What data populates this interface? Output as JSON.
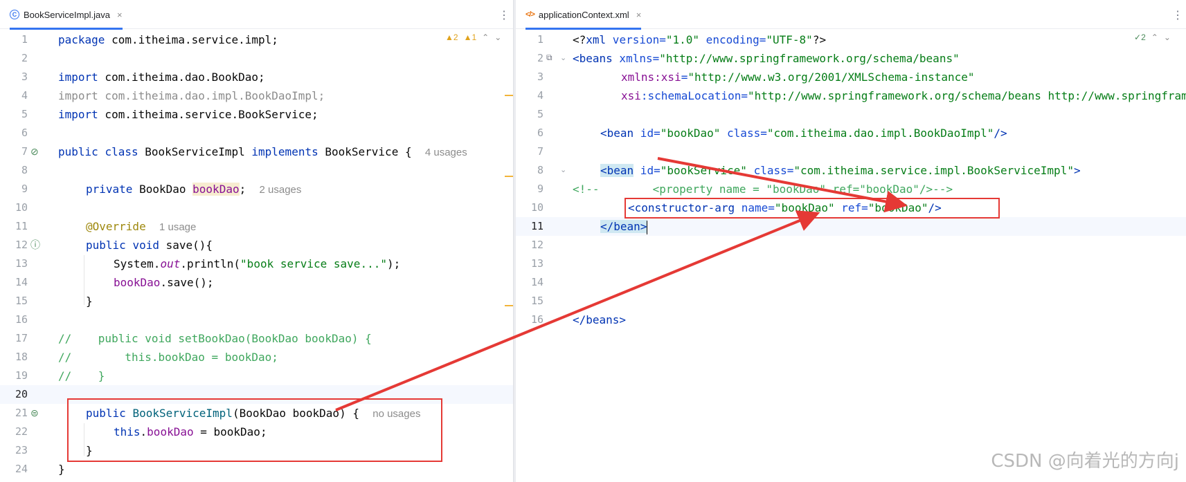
{
  "left_editor": {
    "tab": {
      "filename": "BookServiceImpl.java",
      "icon": "java-class-icon",
      "close": "×"
    },
    "inspections": {
      "warnings": "2",
      "weak_warnings": "1"
    },
    "lines": {
      "n1": "1",
      "n2": "2",
      "n3": "3",
      "n4": "4",
      "n5": "5",
      "n6": "6",
      "n7": "7",
      "n8": "8",
      "n9": "9",
      "n10": "10",
      "n11": "11",
      "n12": "12",
      "n13": "13",
      "n14": "14",
      "n15": "15",
      "n16": "16",
      "n17": "17",
      "n18": "18",
      "n19": "19",
      "n20": "20",
      "n21": "21",
      "n22": "22",
      "n23": "23",
      "n24": "24"
    },
    "code": {
      "l1_kw": "package",
      "l1_rest": " com.itheima.service.impl;",
      "l3_kw": "import",
      "l3_rest": " com.itheima.dao.BookDao;",
      "l4": "import com.itheima.dao.impl.BookDaoImpl;",
      "l5_kw": "import",
      "l5_rest": " com.itheima.service.BookService;",
      "l7_kw1": "public",
      "l7_kw2": "class",
      "l7_name": "BookServiceImpl",
      "l7_kw3": "implements",
      "l7_iface": "BookService {",
      "l7_hint": "4 usages",
      "l9_kw": "private",
      "l9_type": "BookDao",
      "l9_field": "bookDao",
      "l9_semi": ";",
      "l9_hint": "2 usages",
      "l11_ann": "@Override",
      "l11_hint": "1 usage",
      "l12_kw1": "public",
      "l12_kw2": "void",
      "l12_rest": "save(){",
      "l13_sys": "System.",
      "l13_out": "out",
      "l13_print": ".println(",
      "l13_str": "\"book service save...\"",
      "l13_end": ");",
      "l14_field": "bookDao",
      "l14_rest": ".save();",
      "l15": "}",
      "l17": "//    public void setBookDao(BookDao bookDao) {",
      "l18": "//        this.bookDao = bookDao;",
      "l19": "//    }",
      "l21_kw": "public",
      "l21_name": "BookServiceImpl",
      "l21_rest": "(BookDao bookDao) {",
      "l21_hint": "no usages",
      "l22_kw": "this",
      "l22_field": "bookDao",
      "l22_rest": " = bookDao;",
      "l23": "}",
      "l24": "}"
    }
  },
  "right_editor": {
    "tab": {
      "filename": "applicationContext.xml",
      "icon": "xml-file-icon",
      "close": "×"
    },
    "inspections": {
      "ok_count": "2"
    },
    "lines": {
      "n1": "1",
      "n2": "2",
      "n3": "3",
      "n4": "4",
      "n5": "5",
      "n6": "6",
      "n7": "7",
      "n8": "8",
      "n9": "9",
      "n10": "10",
      "n11": "11",
      "n12": "12",
      "n13": "13",
      "n14": "14",
      "n15": "15",
      "n16": "16"
    },
    "code": {
      "l1_open": "<?",
      "l1_xml": "xml",
      "l1_version_attr": " version=",
      "l1_version_val": "\"1.0\"",
      "l1_enc_attr": " encoding=",
      "l1_enc_val": "\"UTF-8\"",
      "l1_close": "?>",
      "l2_tag": "<beans",
      "l2_attr": " xmlns=",
      "l2_val": "\"http://www.springframework.org/schema/beans\"",
      "l3_ns": "xmlns:xsi",
      "l3_eq": "=",
      "l3_val": "\"http://www.w3.org/2001/XMLSchema-instance\"",
      "l4_ns": "xsi",
      "l4_attr": ":schemaLocation=",
      "l4_val": "\"http://www.springframework.org/schema/beans http://www.springframework.org/schema/beans/spring-beans.xsd\"",
      "l6_tag": "<bean",
      "l6_id_attr": " id=",
      "l6_id_val": "\"bookDao\"",
      "l6_class_attr": " class=",
      "l6_class_val": "\"com.itheima.dao.impl.BookDaoImpl\"",
      "l6_close": "/>",
      "l8_tag": "<bean",
      "l8_id_attr": " id=",
      "l8_id_val": "\"bookService\"",
      "l8_class_attr": " class=",
      "l8_class_val": "\"com.itheima.service.impl.BookServiceImpl\"",
      "l8_close": ">",
      "l9": "<!--        <property name = \"bookDao\" ref=\"bookDao\"/>-->",
      "l10_tag": "<constructor-arg",
      "l10_name_attr": " name=",
      "l10_name_val": "\"bookDao\"",
      "l10_ref_attr": " ref=",
      "l10_ref_val": "\"bookDao\"",
      "l10_close": "/>",
      "l11_close": "</bean>",
      "l16_close": "</beans>"
    }
  },
  "watermark": "CSDN @向着光的方向j",
  "colors": {
    "annotation_red": "#e53935",
    "keyword": "#0033b3",
    "string": "#067d17",
    "comment": "#3fa75d"
  }
}
